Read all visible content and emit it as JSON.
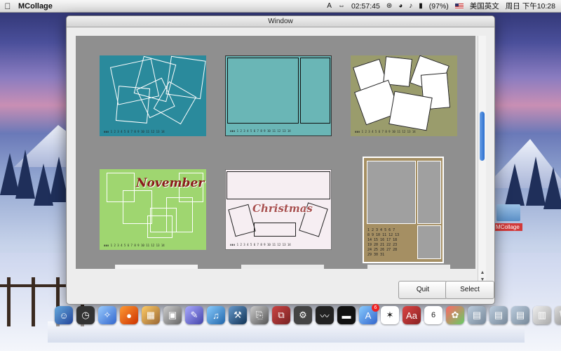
{
  "menubar": {
    "app_name": "MCollage",
    "time_display": "02:57:45",
    "battery": "(97%)",
    "input_method": "美国英文",
    "clock": "周日 下午10:28"
  },
  "window": {
    "title": "Window",
    "quit_label": "Quit",
    "select_label": "Select"
  },
  "templates": {
    "november_text": "November",
    "christmas_text": "Christmas"
  },
  "desktop": {
    "icon_label": "MCollage"
  },
  "dock": {
    "calendar_day": "6",
    "mail_badge": "6"
  }
}
